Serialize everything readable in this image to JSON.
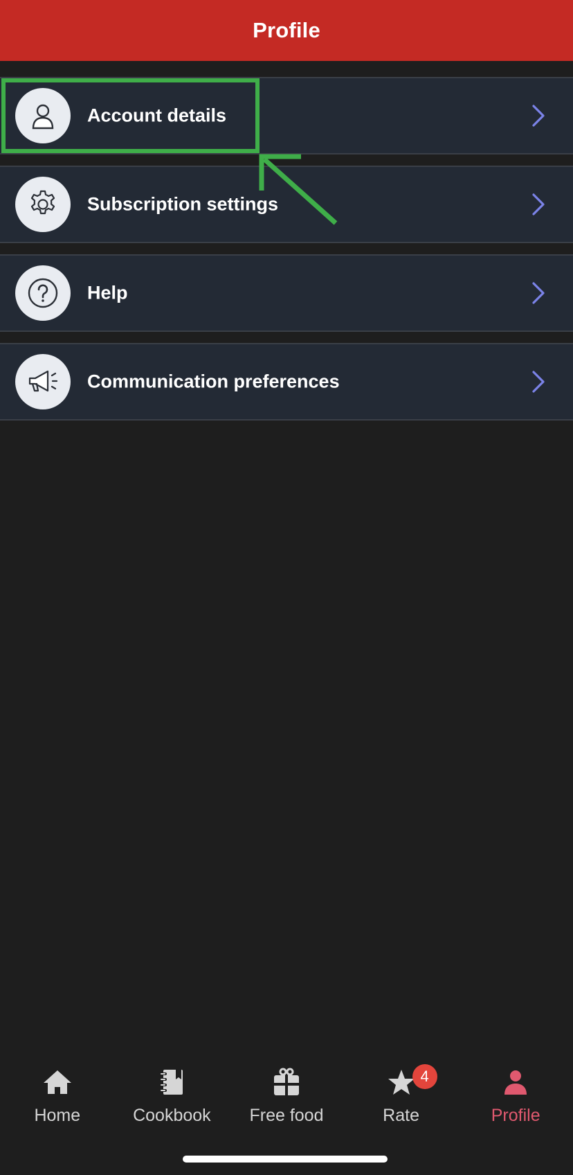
{
  "header": {
    "title": "Profile"
  },
  "menu": {
    "items": [
      {
        "label": "Account details",
        "icon": "person-icon"
      },
      {
        "label": "Subscription settings",
        "icon": "gear-icon"
      },
      {
        "label": "Help",
        "icon": "question-icon"
      },
      {
        "label": "Communication preferences",
        "icon": "megaphone-icon"
      }
    ]
  },
  "tabbar": {
    "tabs": [
      {
        "label": "Home",
        "icon": "home-icon"
      },
      {
        "label": "Cookbook",
        "icon": "cookbook-icon"
      },
      {
        "label": "Free food",
        "icon": "gift-icon"
      },
      {
        "label": "Rate",
        "icon": "star-icon",
        "badge": "4"
      },
      {
        "label": "Profile",
        "icon": "profile-icon",
        "active": true
      }
    ]
  },
  "colors": {
    "header_bg": "#c42a24",
    "page_bg": "#1e1e1e",
    "row_bg": "#232a35",
    "chevron": "#7b83e8",
    "active_tab": "#e0596f",
    "badge": "#e3453c",
    "annotation": "#3fae49"
  }
}
